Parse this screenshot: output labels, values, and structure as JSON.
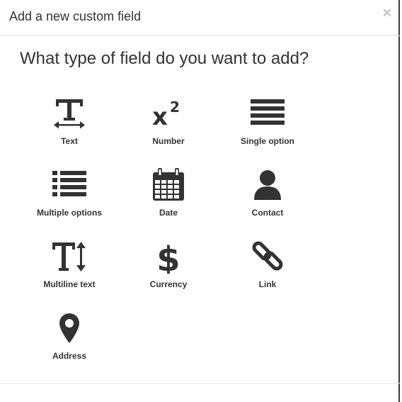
{
  "header": {
    "title": "Add a new custom field",
    "close_label": "×"
  },
  "body": {
    "question": "What type of field do you want to add?"
  },
  "field_types": [
    {
      "label": "Text",
      "icon": "text-icon"
    },
    {
      "label": "Number",
      "icon": "superscript-icon"
    },
    {
      "label": "Single option",
      "icon": "single-option-icon"
    },
    {
      "label": "Multiple options",
      "icon": "list-icon"
    },
    {
      "label": "Date",
      "icon": "calendar-icon"
    },
    {
      "label": "Contact",
      "icon": "user-icon"
    },
    {
      "label": "Multiline text",
      "icon": "text-height-icon"
    },
    {
      "label": "Currency",
      "icon": "dollar-icon"
    },
    {
      "label": "Link",
      "icon": "link-icon"
    },
    {
      "label": "Address",
      "icon": "map-marker-icon"
    }
  ],
  "colors": {
    "icon": "#333333",
    "close": "#c4c4c4",
    "divider": "#e5e5e5"
  }
}
